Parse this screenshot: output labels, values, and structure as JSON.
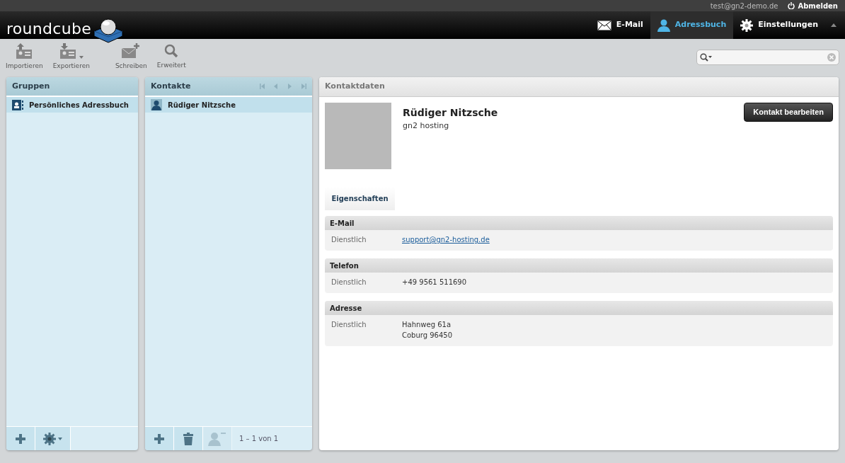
{
  "topbar": {
    "user": "test@gn2-demo.de",
    "logout": "Abmelden"
  },
  "logo": "roundcube",
  "nav": [
    {
      "label": "E-Mail",
      "kind": "mail",
      "selected": false
    },
    {
      "label": "Adressbuch",
      "kind": "person",
      "selected": true
    },
    {
      "label": "Einstellungen",
      "kind": "gear",
      "selected": false
    }
  ],
  "toolbar": [
    {
      "label": "Importieren",
      "kind": "import",
      "menu": false
    },
    {
      "label": "Exportieren",
      "kind": "export",
      "menu": true
    },
    {
      "label": "Schreiben",
      "kind": "compose",
      "menu": false
    },
    {
      "label": "Erweitert",
      "kind": "search",
      "menu": false
    }
  ],
  "groups": {
    "title": "Gruppen",
    "items": [
      {
        "label": "Persönliches Adressbuch",
        "selected": true
      }
    ],
    "footer": [
      {
        "kind": "add",
        "disabled": false
      },
      {
        "kind": "gear",
        "disabled": false
      }
    ]
  },
  "contacts": {
    "title": "Kontakte",
    "items": [
      {
        "label": "Rüdiger Nitzsche",
        "selected": true
      }
    ],
    "footer": [
      {
        "kind": "add",
        "disabled": false
      },
      {
        "kind": "trash",
        "disabled": false
      },
      {
        "kind": "remove-person",
        "disabled": true
      }
    ],
    "count": "1 – 1 von 1"
  },
  "details": {
    "title": "Kontaktdaten",
    "name": "Rüdiger Nitzsche",
    "organization": "gn2 hosting",
    "edit_button": "Kontakt bearbeiten",
    "tabs": [
      {
        "label": "Eigenschaften",
        "selected": true
      }
    ],
    "sections": [
      {
        "title": "E-Mail",
        "rows": [
          {
            "label": "Dienstlich",
            "kind": "link",
            "lines": [
              "support@gn2-hosting.de"
            ]
          }
        ]
      },
      {
        "title": "Telefon",
        "rows": [
          {
            "label": "Dienstlich",
            "kind": "text",
            "lines": [
              "+49 9561 511690"
            ]
          }
        ]
      },
      {
        "title": "Adresse",
        "rows": [
          {
            "label": "Dienstlich",
            "kind": "text",
            "lines": [
              "Hahnweg 61a",
              "Coburg 96450"
            ]
          }
        ]
      }
    ]
  }
}
